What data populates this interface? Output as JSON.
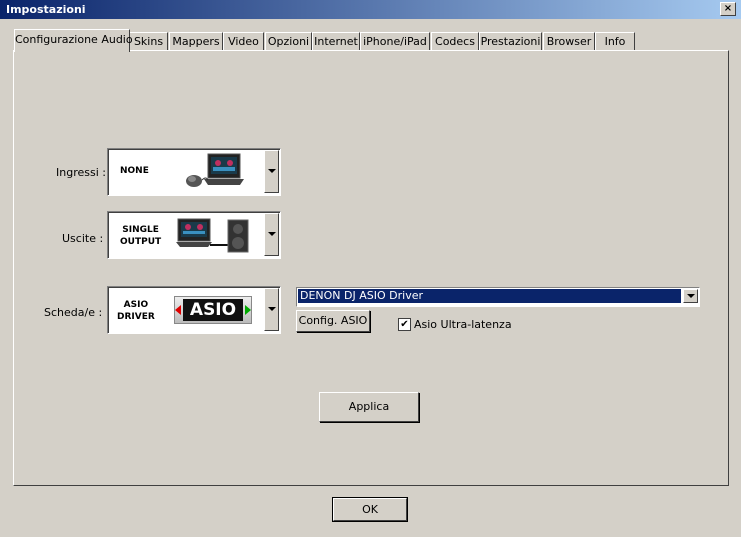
{
  "window": {
    "title": "Impostazioni",
    "close_label": "×"
  },
  "tabs": [
    {
      "label": "Configurazione Audio",
      "active": true
    },
    {
      "label": "Skins"
    },
    {
      "label": "Mappers"
    },
    {
      "label": "Video"
    },
    {
      "label": "Opzioni"
    },
    {
      "label": "Internet"
    },
    {
      "label": "iPhone/iPad"
    },
    {
      "label": "Codecs"
    },
    {
      "label": "Prestazioni"
    },
    {
      "label": "Browser"
    },
    {
      "label": "Info"
    }
  ],
  "inputs": {
    "label": "Ingressi :",
    "value": "NONE"
  },
  "outputs": {
    "label": "Uscite :",
    "value_line1": "SINGLE",
    "value_line2": "OUTPUT"
  },
  "soundcard": {
    "label": "Scheda/e :",
    "value_line1": "ASIO",
    "value_line2": "DRIVER",
    "logo_text": "ASIO"
  },
  "driver_dropdown": {
    "selected": "DENON DJ ASIO Driver"
  },
  "asio_config_button": "Config. ASIO",
  "ultra_latency": {
    "label": "Asio Ultra-latenza",
    "checked": true,
    "mark": "✔"
  },
  "apply_button": "Applica",
  "ok_button": "OK",
  "colors": {
    "selection": "#0a246a",
    "title_start": "#0a246a",
    "title_end": "#a6caf0"
  }
}
